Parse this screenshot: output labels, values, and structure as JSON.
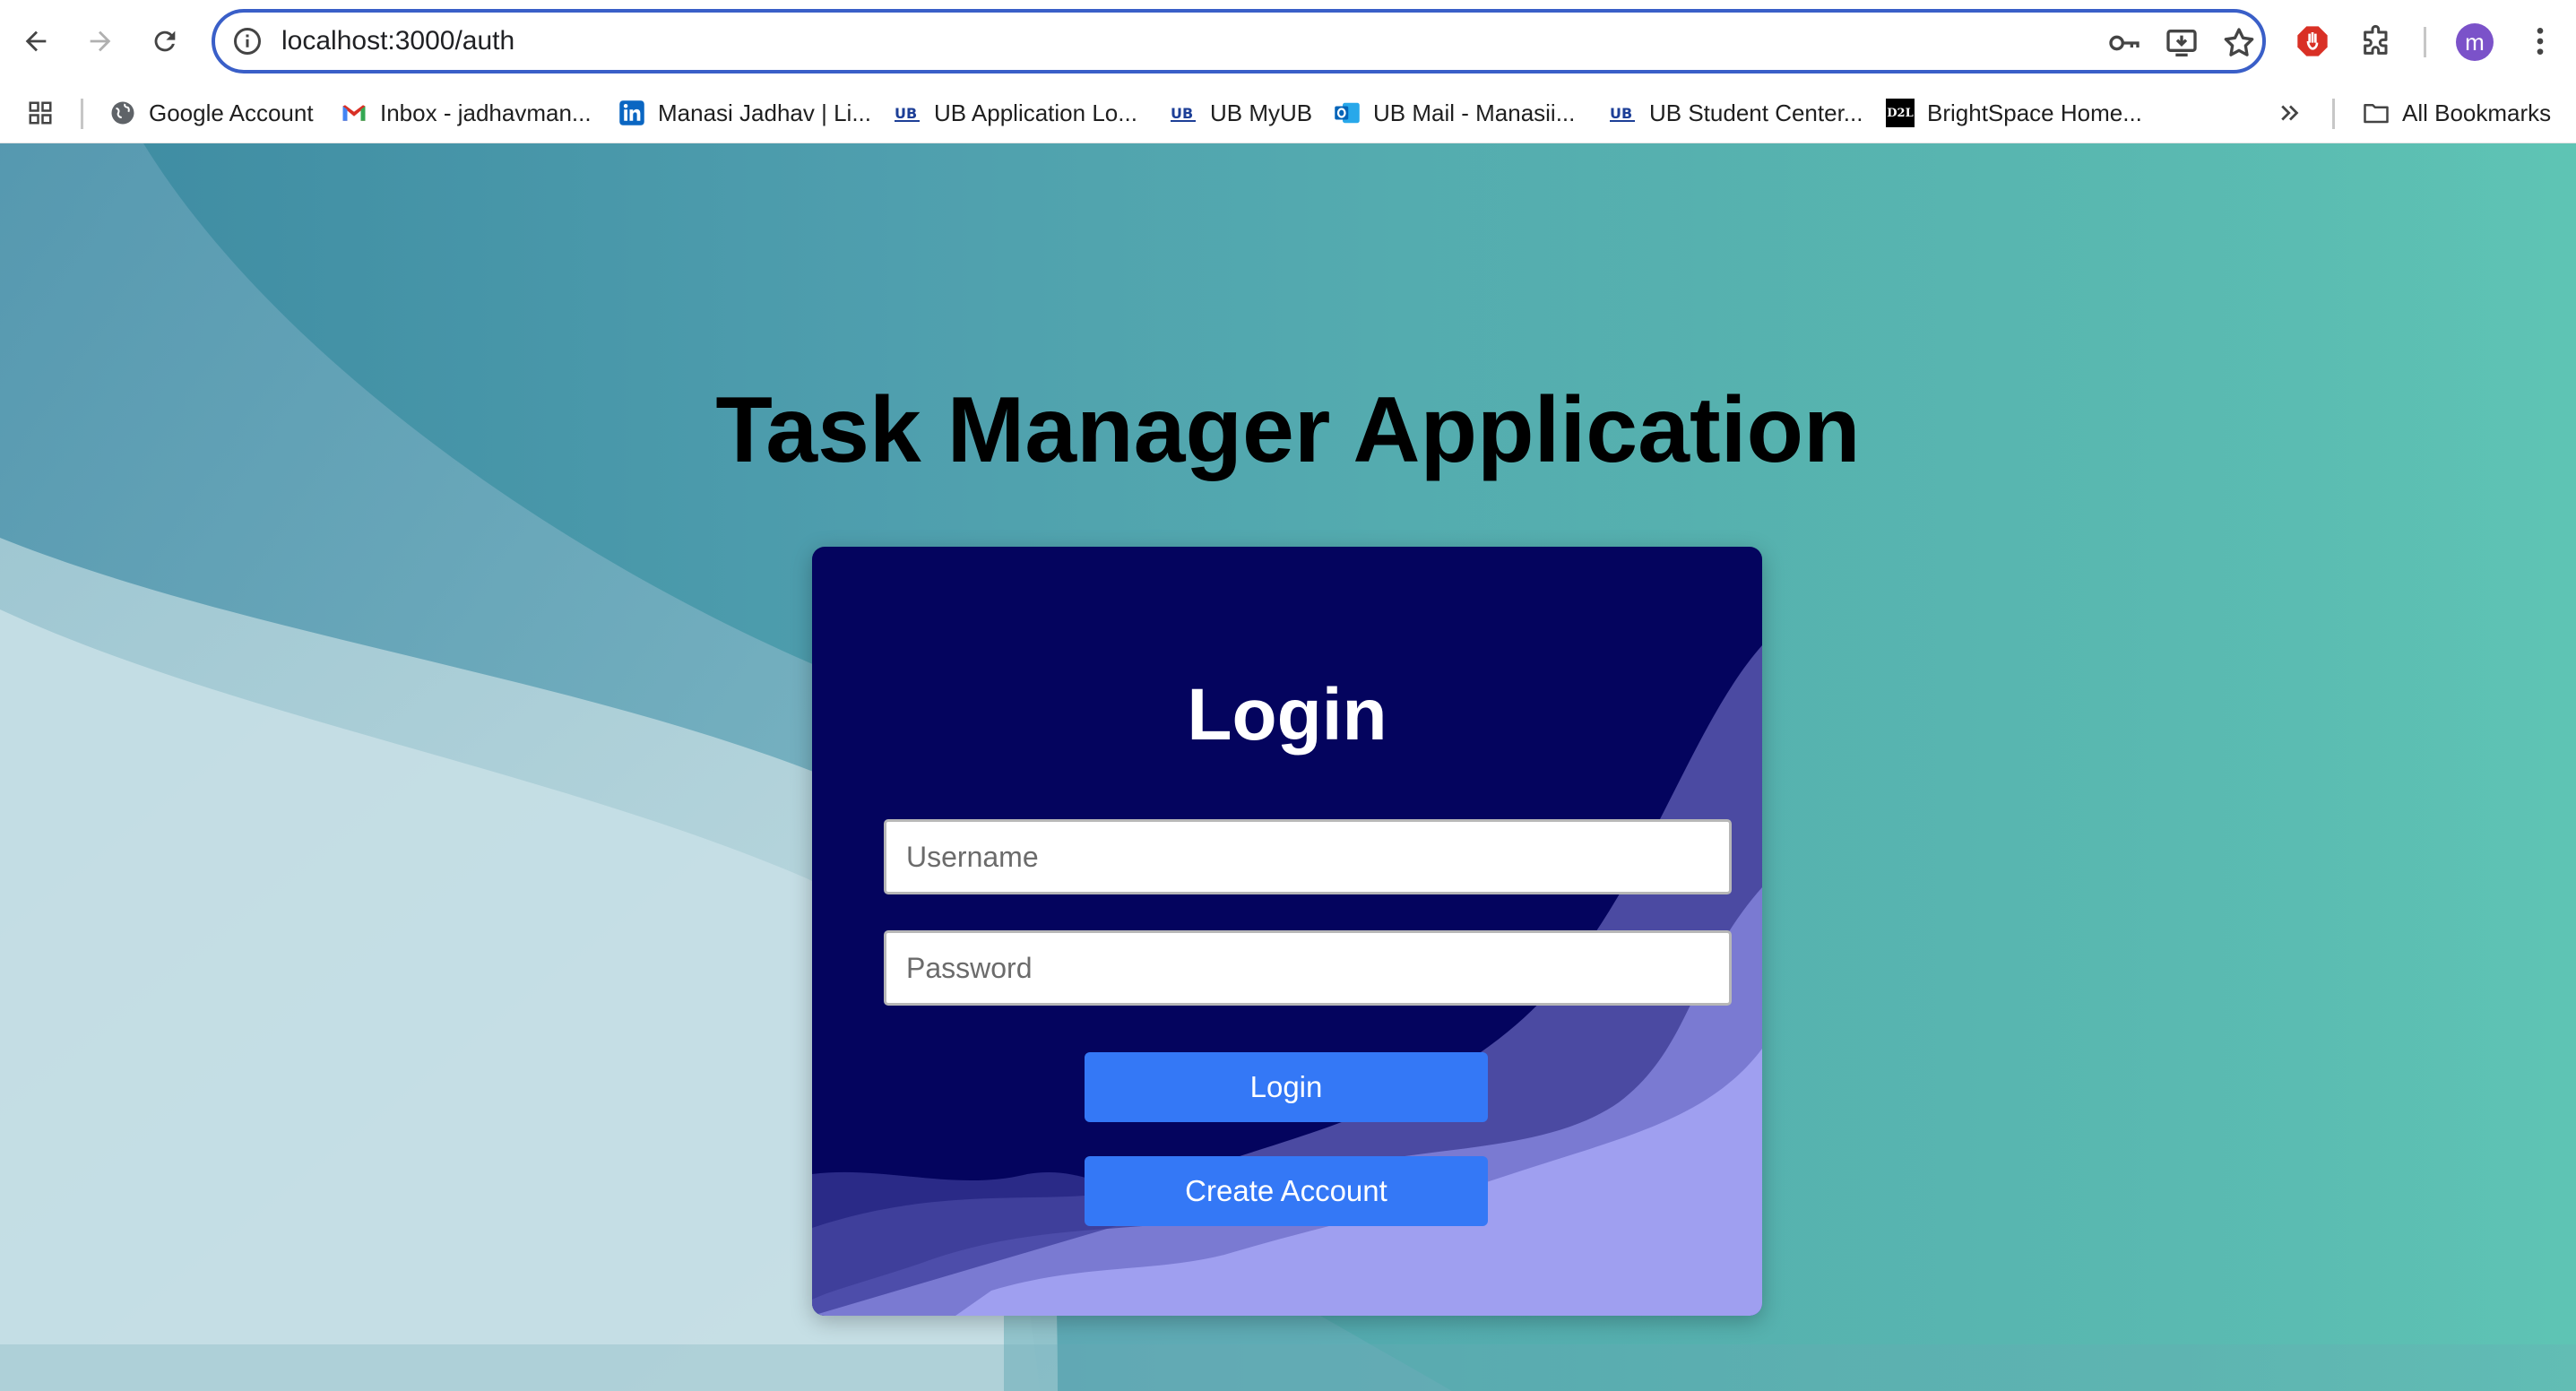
{
  "browser": {
    "url": "localhost:3000/auth",
    "profile_initial": "m"
  },
  "bookmarks": {
    "items": [
      {
        "label": "Google Account",
        "icon": "globe-icon"
      },
      {
        "label": "Inbox - jadhavman...",
        "icon": "gmail-icon"
      },
      {
        "label": "Manasi Jadhav | Li...",
        "icon": "linkedin-icon"
      },
      {
        "label": "UB Application Lo...",
        "icon": "ub-icon"
      },
      {
        "label": "UB MyUB",
        "icon": "ub-icon"
      },
      {
        "label": "UB Mail - Manasii...",
        "icon": "outlook-icon"
      },
      {
        "label": "UB Student Center...",
        "icon": "ub-icon"
      },
      {
        "label": "BrightSpace Home...",
        "icon": "d2l-icon"
      }
    ],
    "all_bookmarks_label": "All Bookmarks",
    "d2l_text": "D2L"
  },
  "page": {
    "title": "Task Manager Application",
    "login_title": "Login",
    "username_placeholder": "Username",
    "password_placeholder": "Password",
    "login_button": "Login",
    "create_account_button": "Create Account"
  },
  "colors": {
    "omnibox_border": "#3a5fc8",
    "card_background": "#04045e",
    "button": "#3478f6",
    "avatar": "#7b52c9"
  }
}
